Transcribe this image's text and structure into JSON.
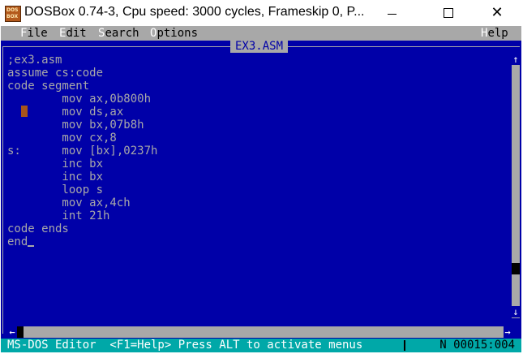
{
  "window": {
    "icon_line1": "DOS",
    "icon_line2": "BOX",
    "title": "DOSBox 0.74-3, Cpu speed:     3000 cycles, Frameskip  0, P...",
    "minimize_glyph": "—",
    "maximize_glyph": "☐",
    "close_glyph": "✕"
  },
  "menu": [
    {
      "hot": "F",
      "rest": "ile"
    },
    {
      "hot": "E",
      "rest": "dit"
    },
    {
      "hot": "S",
      "rest": "earch"
    },
    {
      "hot": "O",
      "rest": "ptions"
    },
    {
      "hot": "H",
      "rest": "elp"
    }
  ],
  "editor": {
    "filename": "EX3.ASM",
    "lines": [
      ";ex3.asm",
      "assume cs:code",
      "code segment",
      "        mov ax,0b800h",
      "        mov ds,ax",
      "        mov bx,07b8h",
      "        mov cx,8",
      "s:      mov [bx],0237h",
      "        inc bx",
      "        inc bx",
      "        loop s",
      "        mov ax,4ch",
      "        int 21h",
      "code ends",
      "end"
    ],
    "vscroll_up_glyph": "↑",
    "vscroll_down_glyph": "↓",
    "vscroll_thumb_position": 0.86,
    "hscroll_left_glyph": "←",
    "hscroll_right_glyph": "→"
  },
  "status": {
    "text": "MS-DOS Editor  <F1=Help> Press ALT to activate menus",
    "position": "N 00015:004"
  },
  "colors": {
    "dos_blue": "#0000a8",
    "dos_gray": "#a8a8a8",
    "dos_cyan": "#00a8a8",
    "marker_brown": "#a8541a"
  }
}
